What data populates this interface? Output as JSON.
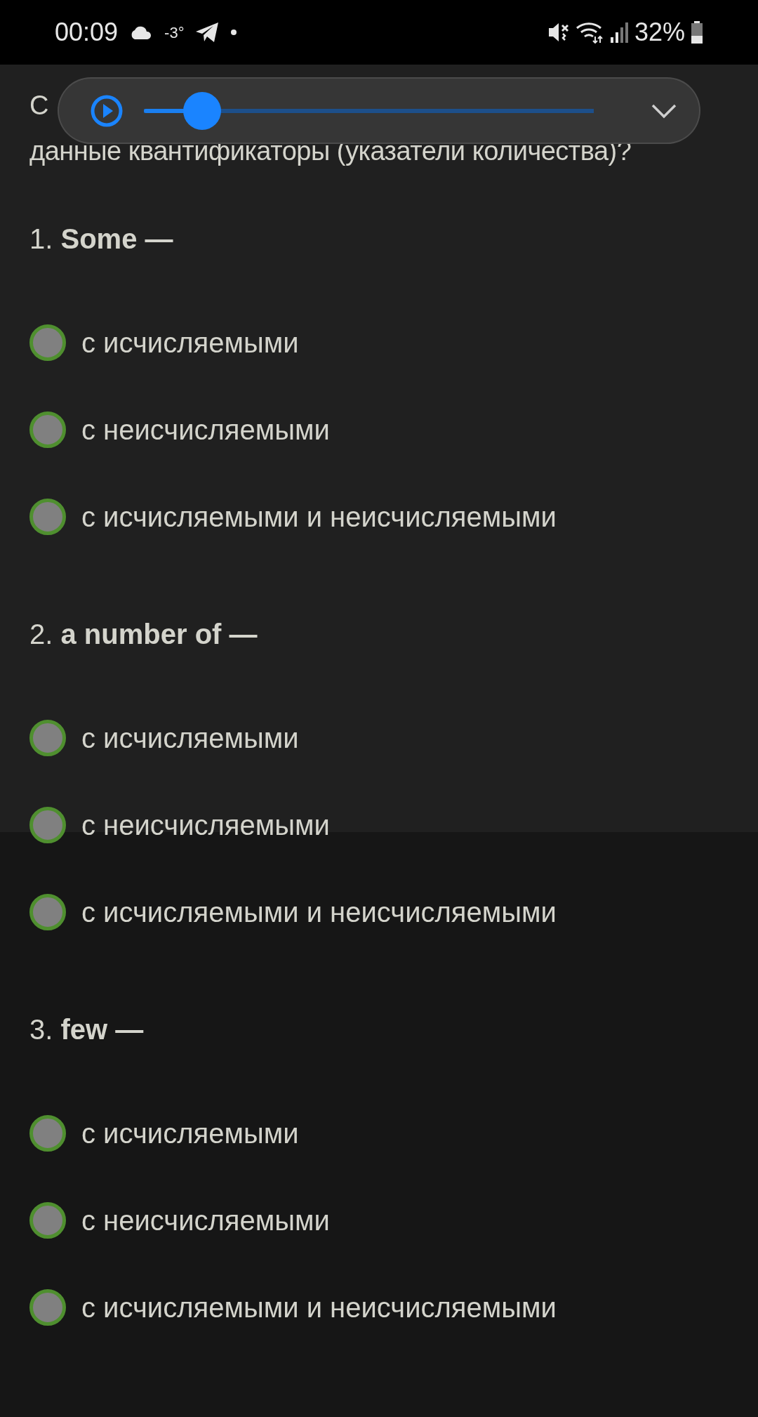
{
  "status_bar": {
    "time": "00:09",
    "temperature": "-3°",
    "battery": "32%"
  },
  "audio_player": {
    "level": 0.13
  },
  "question_lines": [
    "С",
    "данные квантификаторы (указатели количества)?"
  ],
  "items": [
    {
      "heading": "1. **Some —**",
      "options": [
        {
          "label": "с исчисляемыми",
          "selected": false
        },
        {
          "label": "с неисчисляемыми",
          "selected": false
        },
        {
          "label": "с исчисляемыми и неисчисляемыми",
          "selected": false
        }
      ]
    },
    {
      "heading": "2. **a number of —**",
      "options": [
        {
          "label": "с исчисляемыми",
          "selected": false
        },
        {
          "label": "с неисчисляемыми",
          "selected": false
        },
        {
          "label": "с исчисляемыми и неисчисляемыми",
          "selected": false
        }
      ]
    },
    {
      "heading": "3. **few —**",
      "options": [
        {
          "label": "с исчисляемыми",
          "selected": false
        },
        {
          "label": "с неисчисляемыми",
          "selected": false
        },
        {
          "label": "с исчисляемыми и неисчисляемыми",
          "selected": false
        }
      ]
    }
  ]
}
